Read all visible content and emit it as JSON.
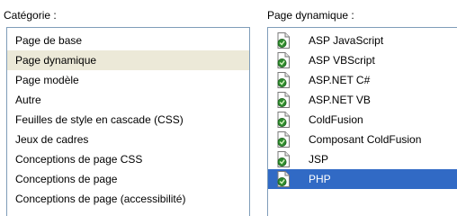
{
  "category": {
    "label": "Catégorie :",
    "items": [
      {
        "label": "Page de base",
        "state": "normal"
      },
      {
        "label": "Page dynamique",
        "state": "selected-inactive"
      },
      {
        "label": "Page modèle",
        "state": "normal"
      },
      {
        "label": "Autre",
        "state": "normal"
      },
      {
        "label": "Feuilles de style en cascade (CSS)",
        "state": "normal"
      },
      {
        "label": "Jeux de cadres",
        "state": "normal"
      },
      {
        "label": "Conceptions de page CSS",
        "state": "normal"
      },
      {
        "label": "Conceptions de page",
        "state": "normal"
      },
      {
        "label": "Conceptions de page (accessibilité)",
        "state": "normal"
      }
    ]
  },
  "page_type": {
    "label": "Page dynamique :",
    "item_icon": "dynamic-document-icon",
    "items": [
      {
        "label": "ASP JavaScript",
        "state": "normal"
      },
      {
        "label": "ASP VBScript",
        "state": "normal"
      },
      {
        "label": "ASP.NET C#",
        "state": "normal"
      },
      {
        "label": "ASP.NET VB",
        "state": "normal"
      },
      {
        "label": "ColdFusion",
        "state": "normal"
      },
      {
        "label": "Composant ColdFusion",
        "state": "normal"
      },
      {
        "label": "JSP",
        "state": "normal"
      },
      {
        "label": "PHP",
        "state": "selected-active"
      }
    ]
  },
  "colors": {
    "selection_active": "#316ac5",
    "selection_inactive": "#ece9d8",
    "listbox_border": "#7f9db9",
    "icon_green": "#2e8b2e"
  }
}
